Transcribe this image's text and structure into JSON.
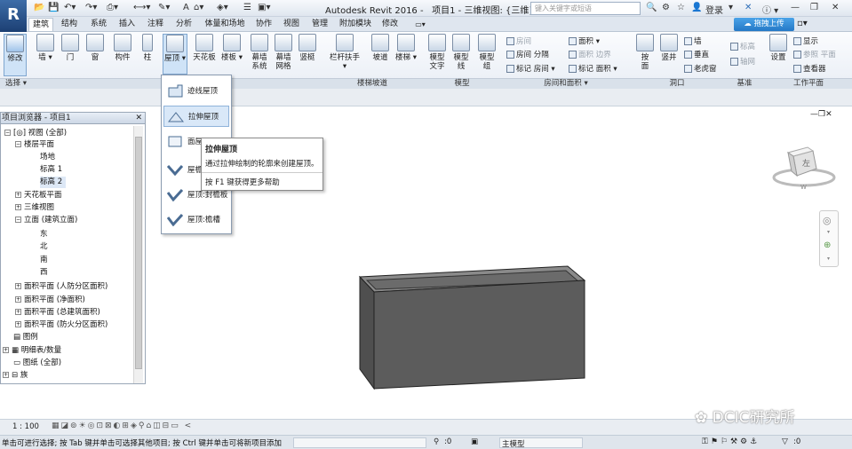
{
  "app": {
    "logo_letter": "R",
    "title": "Autodesk Revit 2016 -",
    "project_view": "项目1 - 三维视图: {三维}"
  },
  "search": {
    "placeholder": "键入关键字或短语"
  },
  "account": {
    "login": "登录"
  },
  "upload_button": "拖拽上传",
  "tabs": [
    "建筑",
    "结构",
    "系统",
    "插入",
    "注释",
    "分析",
    "体量和场地",
    "协作",
    "视图",
    "管理",
    "附加模块",
    "修改"
  ],
  "ribbon": {
    "modify": "修改",
    "wall": "墙",
    "door": "门",
    "window": "窗",
    "component": "构件",
    "column": "柱",
    "roof": "屋顶",
    "ceiling": "天花板",
    "floor": "楼板",
    "curtain_system": "幕墙\n系统",
    "curtain_grid": "幕墙\n网格",
    "mullion": "竖梃",
    "railing": "栏杆扶手",
    "ramp": "坡道",
    "stair": "楼梯",
    "model_text": "模型\n文字",
    "model_line": "模型\n线",
    "model_group": "模型\n组",
    "room": "房间",
    "room_separator": "分隔",
    "tag_room": "标记",
    "room2": "房间",
    "area": "面积",
    "area_boundary": "边界",
    "tag_area": "标记",
    "area2": "面积",
    "by_face": "按\n面",
    "shaft": "竖井",
    "wall_opening": "墙",
    "vertical": "垂直",
    "dormer": "老虎窗",
    "level": "标高",
    "grid": "轴网",
    "set": "设置",
    "show": "显示",
    "ref_plane": "参照 平面",
    "viewer": "查看器"
  },
  "panels": {
    "select": "选择",
    "build": "构建",
    "circulation": "楼梯坡道",
    "model": "模型",
    "room_area": "房间和面积",
    "opening": "洞口",
    "datum": "基准",
    "work_plane": "工作平面"
  },
  "roof_menu": {
    "items": [
      "迹线屋顶",
      "拉伸屋顶",
      "面屋",
      "屋檐",
      "屋顶:封檐板",
      "屋顶:檐槽"
    ]
  },
  "tooltip": {
    "title": "拉伸屋顶",
    "description": "通过拉伸绘制的轮廓来创建屋顶。",
    "help": "按 F1 键获得更多帮助"
  },
  "browser": {
    "title": "项目浏览器 - 项目1",
    "nodes": [
      "视图 (全部)",
      "楼层平面",
      "场地",
      "标高 1",
      "标高 2",
      "天花板平面",
      "三维视图",
      "立面 (建筑立面)",
      "东",
      "北",
      "南",
      "西",
      "面积平面 (人防分区面积)",
      "面积平面 (净面积)",
      "面积平面 (总建筑面积)",
      "面积平面 (防火分区面积)",
      "图例",
      "明细表/数量",
      "图纸 (全部)",
      "族"
    ]
  },
  "viewcube": {
    "face": "左",
    "compass": "W"
  },
  "status": {
    "scale": "1 : 100",
    "zero1": ":0",
    "main_model": "主模型",
    "zero2": ":0"
  },
  "message": "单击可进行选择; 按 Tab 键并单击可选择其他项目; 按 Ctrl 键并单击可将新项目添加",
  "watermark": "DCIC研究所",
  "colors": {
    "accent": "#3d6da8",
    "selection": "#d9e8f8",
    "wall_dark": "#5a5a5a"
  }
}
